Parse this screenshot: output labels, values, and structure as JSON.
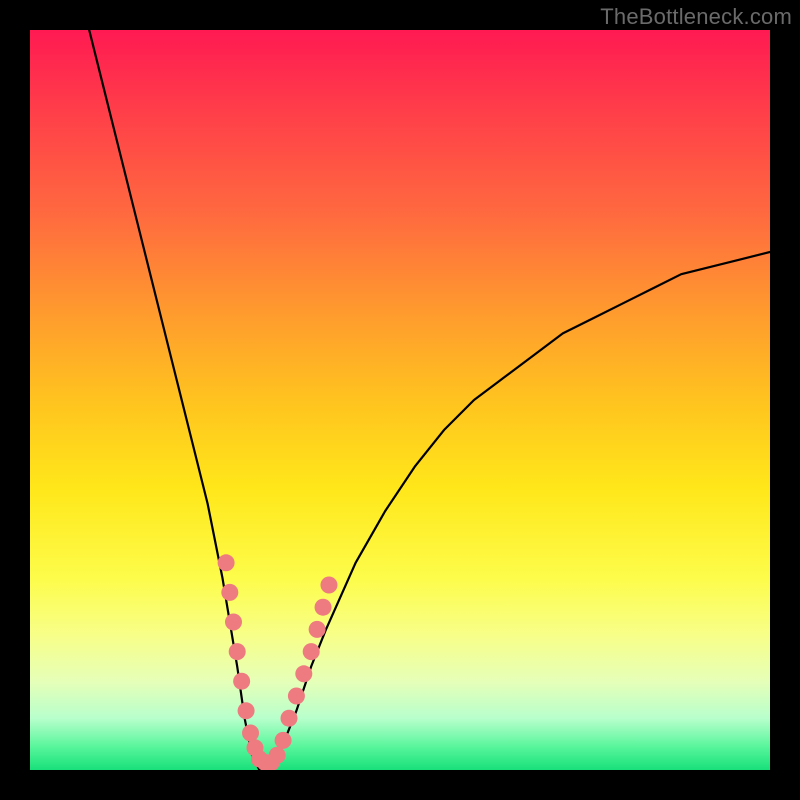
{
  "watermark": "TheBottleneck.com",
  "colors": {
    "curve_stroke": "#000000",
    "dot_fill": "#ed7b80",
    "dot_stroke": "#d55a60",
    "frame": "#000000"
  },
  "chart_data": {
    "type": "line",
    "title": "",
    "xlabel": "",
    "ylabel": "",
    "xlim": [
      0,
      100
    ],
    "ylim": [
      0,
      100
    ],
    "grid": false,
    "legend": false,
    "series": [
      {
        "name": "bottleneck-curve",
        "note": "V-shaped curve; y≈0 at minimum, rises steeply on left to ~100 and gently on right to ~70",
        "x": [
          8,
          10,
          12,
          14,
          16,
          18,
          20,
          22,
          24,
          26,
          28,
          29,
          30,
          31,
          32,
          33,
          34,
          36,
          38,
          40,
          44,
          48,
          52,
          56,
          60,
          64,
          68,
          72,
          76,
          80,
          84,
          88,
          92,
          96,
          100
        ],
        "y": [
          100,
          92,
          84,
          76,
          68,
          60,
          52,
          44,
          36,
          26,
          14,
          7,
          2,
          0,
          0,
          1,
          3,
          8,
          14,
          19,
          28,
          35,
          41,
          46,
          50,
          53,
          56,
          59,
          61,
          63,
          65,
          67,
          68,
          69,
          70
        ]
      }
    ],
    "scatter": {
      "name": "highlight-dots",
      "note": "clustered dots near the valley of the curve, roughly 26<=x<=40",
      "points": [
        {
          "x": 26.5,
          "y": 28
        },
        {
          "x": 27.0,
          "y": 24
        },
        {
          "x": 27.5,
          "y": 20
        },
        {
          "x": 28.0,
          "y": 16
        },
        {
          "x": 28.6,
          "y": 12
        },
        {
          "x": 29.2,
          "y": 8
        },
        {
          "x": 29.8,
          "y": 5
        },
        {
          "x": 30.4,
          "y": 3
        },
        {
          "x": 31.0,
          "y": 1.5
        },
        {
          "x": 31.8,
          "y": 1
        },
        {
          "x": 32.6,
          "y": 1
        },
        {
          "x": 33.4,
          "y": 2
        },
        {
          "x": 34.2,
          "y": 4
        },
        {
          "x": 35.0,
          "y": 7
        },
        {
          "x": 36.0,
          "y": 10
        },
        {
          "x": 37.0,
          "y": 13
        },
        {
          "x": 38.0,
          "y": 16
        },
        {
          "x": 38.8,
          "y": 19
        },
        {
          "x": 39.6,
          "y": 22
        },
        {
          "x": 40.4,
          "y": 25
        }
      ]
    }
  }
}
